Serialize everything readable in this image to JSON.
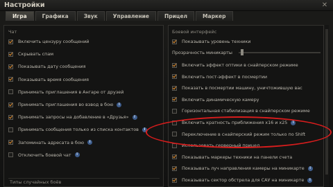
{
  "window": {
    "title": "Настройки"
  },
  "tabs": [
    {
      "label": "Игра",
      "active": true
    },
    {
      "label": "Графика",
      "active": false
    },
    {
      "label": "Звук",
      "active": false
    },
    {
      "label": "Управление",
      "active": false
    },
    {
      "label": "Прицел",
      "active": false
    },
    {
      "label": "Маркер",
      "active": false
    }
  ],
  "left": {
    "section": "Чат",
    "options": [
      {
        "label": "Включить цензуру сообщений",
        "checked": true,
        "info": false
      },
      {
        "label": "Скрывать спам",
        "checked": true,
        "info": false
      },
      {
        "label": "Показывать дату сообщения",
        "checked": true,
        "info": false
      },
      {
        "label": "Показывать время сообщения",
        "checked": true,
        "info": false
      },
      {
        "label": "Принимать приглашения в Ангаре от друзей",
        "checked": false,
        "info": false
      },
      {
        "label": "Принимать приглашения во взвод в бою",
        "checked": true,
        "info": true
      },
      {
        "label": "Принимать запросы на добавление в «Друзья»",
        "checked": true,
        "info": true
      },
      {
        "label": "Принимать сообщения только из списка контактов",
        "checked": false,
        "info": true
      },
      {
        "label": "Запоминать адресата в бою",
        "checked": true,
        "info": true
      },
      {
        "label": "Отключить боевой чат",
        "checked": false,
        "info": true
      }
    ],
    "bottom_section": "Типы случайных боёв"
  },
  "right": {
    "section": "Боевой интерфейс",
    "show_level": {
      "label": "Показывать уровень техники",
      "checked": true
    },
    "minimap_transparency": {
      "label": "Прозрачность миникарты",
      "value_fraction": 0.03
    },
    "options": [
      {
        "label": "Включить эффект оптики в снайперском режиме",
        "checked": true,
        "info": false
      },
      {
        "label": "Включить пост-эффект в посмертии",
        "checked": true,
        "info": false
      },
      {
        "label": "Показать в посмертии машину, уничтожившую вас",
        "checked": true,
        "info": false
      },
      {
        "label": "Включить динамическую камеру",
        "checked": true,
        "info": false
      },
      {
        "label": "Горизонтальная стабилизация в снайперском режиме",
        "checked": false,
        "info": false
      },
      {
        "label": "Включить кратность приближения x16 и x25",
        "checked": false,
        "info": true
      },
      {
        "label": "Переключение в снайперский режим только по Shift",
        "checked": false,
        "info": false
      },
      {
        "label": "Использовать серверный прицел",
        "checked": false,
        "info": false
      },
      {
        "label": "Показывать маркеры техники на панели счета",
        "checked": true,
        "info": false
      },
      {
        "label": "Показывать луч направления камеры на миникарте",
        "checked": true,
        "info": true
      },
      {
        "label": "Показывать сектор обстрела для САУ на миникарте",
        "checked": true,
        "info": true
      }
    ]
  },
  "colors": {
    "check": "#e08a2a",
    "info_badge": "#3e5d8c",
    "highlight": "#d81d1d"
  }
}
